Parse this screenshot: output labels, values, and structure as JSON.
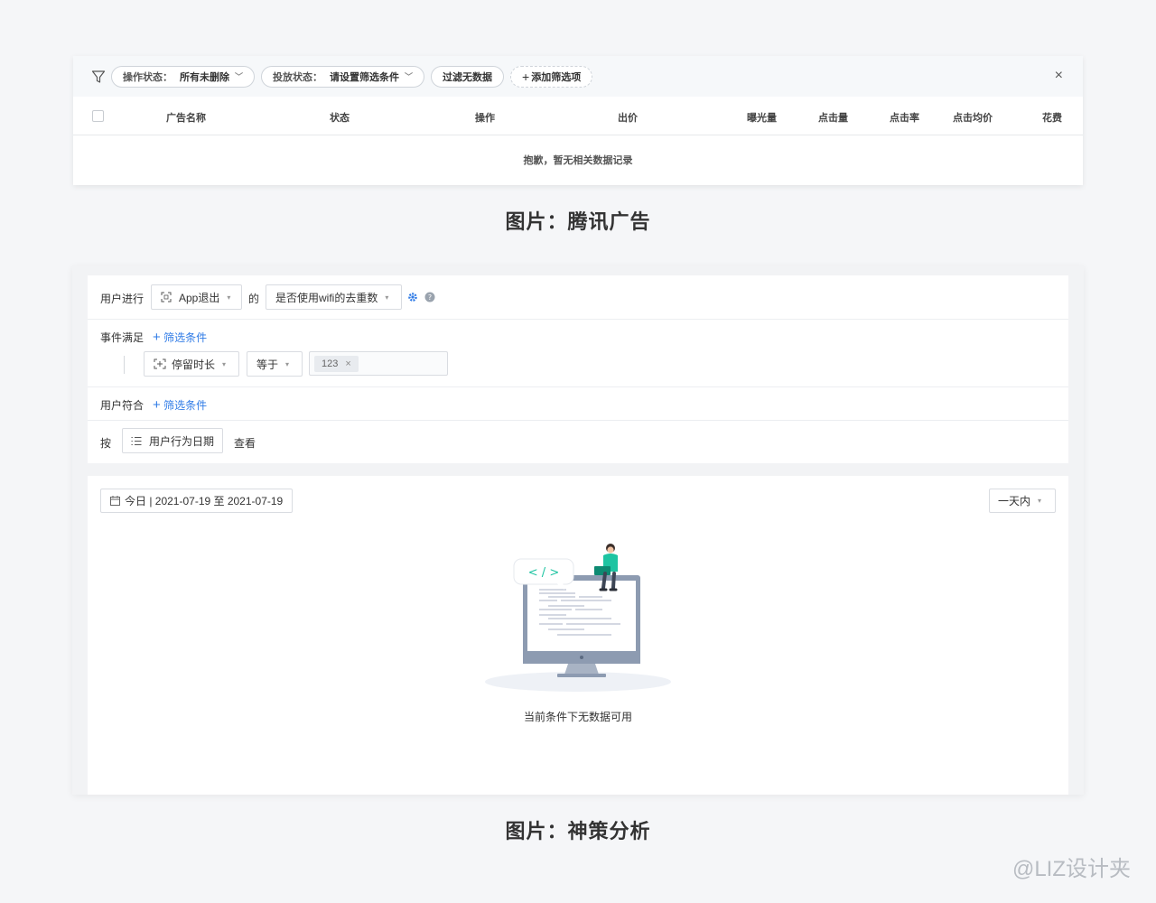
{
  "panel1": {
    "filters": [
      {
        "label": "操作状态：",
        "value": "所有未删除"
      },
      {
        "label": "投放状态：",
        "value": "请设置筛选条件"
      }
    ],
    "filter_no_data": "过滤无数据",
    "add_filter": "添加筛选项",
    "close": "×",
    "columns": [
      "广告名称",
      "状态",
      "操作",
      "出价",
      "曝光量",
      "点击量",
      "点击率",
      "点击均价",
      "花费"
    ],
    "empty_text": "抱歉，暂无相关数据记录"
  },
  "caption1": "图片：腾讯广告",
  "panel2": {
    "row1": {
      "prefix": "用户进行",
      "event": "App退出",
      "joiner": "的",
      "metric": "是否使用wifi的去重数"
    },
    "row2": {
      "label": "事件满足",
      "add": "筛选条件",
      "field": "停留时长",
      "op": "等于",
      "tag": "123"
    },
    "row3": {
      "label": "用户符合",
      "add": "筛选条件"
    },
    "row4": {
      "prefix": "按",
      "group": "用户行为日期",
      "suffix": "查看"
    },
    "date_range": "今日 | 2021-07-19 至 2021-07-19",
    "window": "一天内",
    "code_bubble": "< / >",
    "empty_text": "当前条件下无数据可用"
  },
  "caption2": "图片：神策分析",
  "watermark": "@LIZ设计夹",
  "colors": {
    "accent_blue": "#2f7be6",
    "teal": "#1ec4a2",
    "bg": "#f5f6f8"
  }
}
